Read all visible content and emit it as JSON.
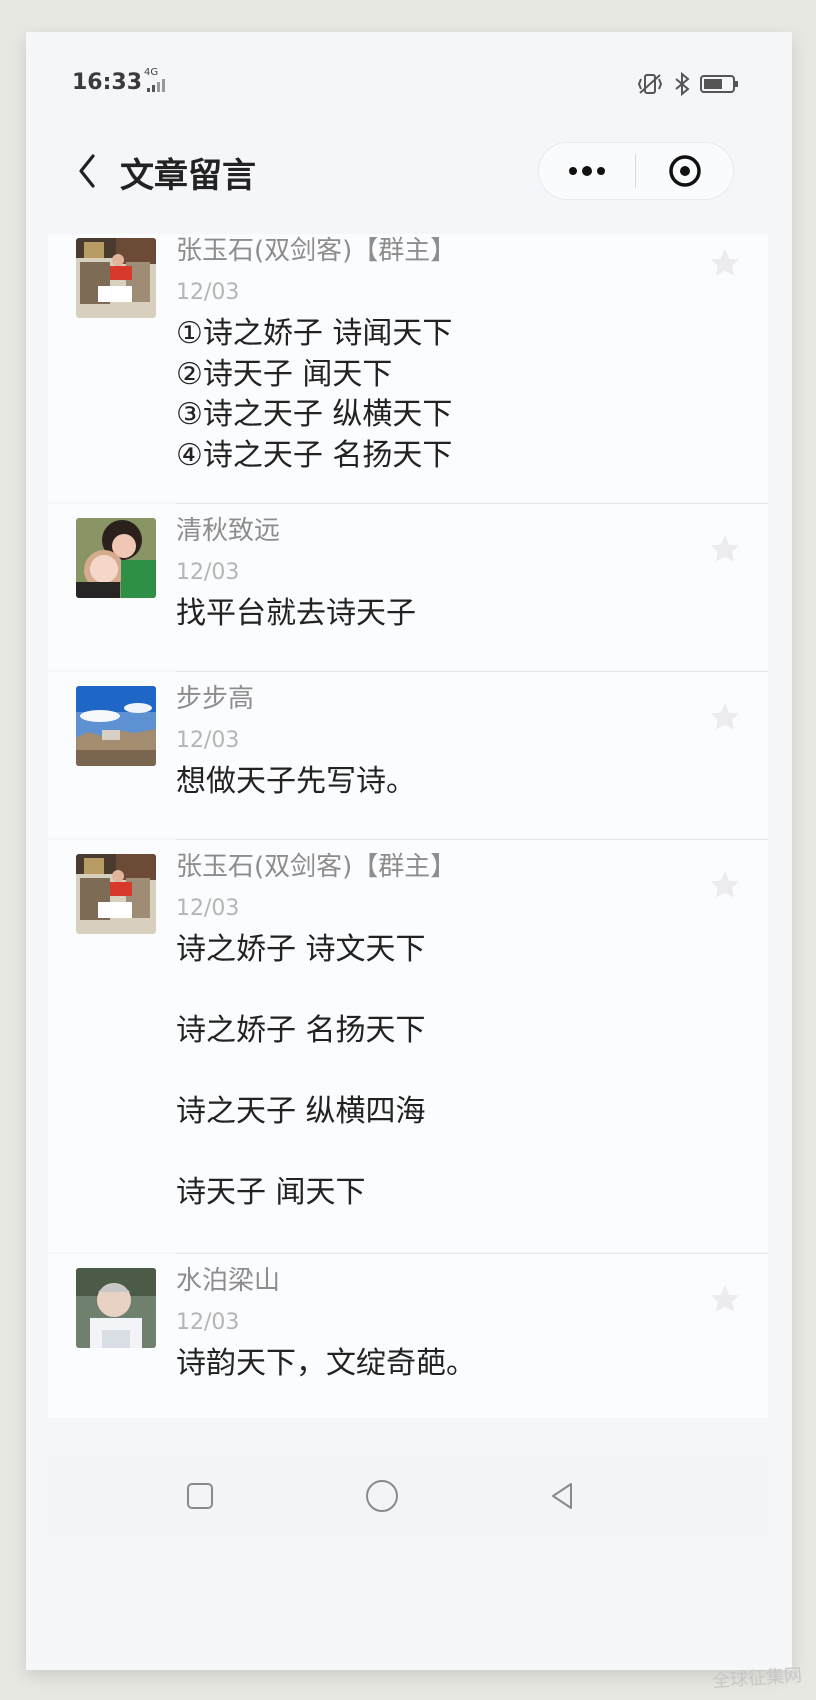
{
  "status_bar": {
    "time": "16:33",
    "network": "4G"
  },
  "header": {
    "title": "文章留言"
  },
  "icons": {
    "back": "chevron-left",
    "more": "three-dots",
    "close": "target-circle",
    "like": "star",
    "nav_recent": "square",
    "nav_home": "circle",
    "nav_back": "triangle-left"
  },
  "comments": [
    {
      "name": "张玉石(双剑客)【群主】",
      "date": "12/03",
      "text": "①诗之娇子 诗闻天下\n②诗天子 闻天下\n③诗之天子 纵横天下\n④诗之天子 名扬天下"
    },
    {
      "name": "清秋致远",
      "date": "12/03",
      "text": "找平台就去诗天子"
    },
    {
      "name": "步步高",
      "date": "12/03",
      "text": "想做天子先写诗。"
    },
    {
      "name": "张玉石(双剑客)【群主】",
      "date": "12/03",
      "text": "诗之娇子 诗文天下\n\n诗之娇子 名扬天下\n\n诗之天子 纵横四海\n\n诗天子 闻天下"
    },
    {
      "name": "水泊梁山",
      "date": "12/03",
      "text": "诗韵天下，文绽奇葩。"
    }
  ],
  "watermark": "全球征集网",
  "colors": {
    "page_background": "#f4f6fa",
    "comment_text": "#222222",
    "meta_text": "#8d8d8d"
  }
}
